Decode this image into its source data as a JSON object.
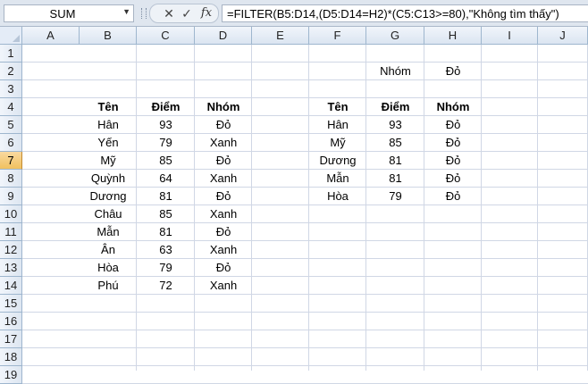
{
  "formula_bar": {
    "name_box": "SUM",
    "cancel_glyph": "✕",
    "enter_glyph": "✓",
    "fx_glyph": "fx",
    "formula": "=FILTER(B5:D14,(D5:D14=H2)*(C5:C13>=80),\"Không tìm thấy\")"
  },
  "columns": [
    "A",
    "B",
    "C",
    "D",
    "E",
    "F",
    "G",
    "H",
    "I",
    "J"
  ],
  "rows": [
    "1",
    "2",
    "3",
    "4",
    "5",
    "6",
    "7",
    "8",
    "9",
    "10",
    "11",
    "12",
    "13",
    "14",
    "15",
    "16",
    "17",
    "18",
    "19"
  ],
  "active_row": "7",
  "criteria": {
    "label": "Nhóm",
    "value": "Đỏ"
  },
  "source_table": {
    "headers": [
      "Tên",
      "Điểm",
      "Nhóm"
    ],
    "rows": [
      [
        "Hân",
        "93",
        "Đỏ"
      ],
      [
        "Yến",
        "79",
        "Xanh"
      ],
      [
        "Mỹ",
        "85",
        "Đỏ"
      ],
      [
        "Quỳnh",
        "64",
        "Xanh"
      ],
      [
        "Dương",
        "81",
        "Đỏ"
      ],
      [
        "Châu",
        "85",
        "Xanh"
      ],
      [
        "Mẫn",
        "81",
        "Đỏ"
      ],
      [
        "Ân",
        "63",
        "Xanh"
      ],
      [
        "Hòa",
        "79",
        "Đỏ"
      ],
      [
        "Phú",
        "72",
        "Xanh"
      ]
    ]
  },
  "result_table": {
    "headers": [
      "Tên",
      "Điểm",
      "Nhóm"
    ],
    "rows": [
      [
        "Hân",
        "93",
        "Đỏ"
      ],
      [
        "Mỹ",
        "85",
        "Đỏ"
      ],
      [
        "Dương",
        "81",
        "Đỏ"
      ],
      [
        "Mẫn",
        "81",
        "Đỏ"
      ],
      [
        "Hòa",
        "79",
        "Đỏ"
      ]
    ]
  },
  "colors": {
    "header_bg": "#dbe5f1",
    "gridline": "#d0d7e5",
    "active_row_header": "#f1c15f"
  }
}
